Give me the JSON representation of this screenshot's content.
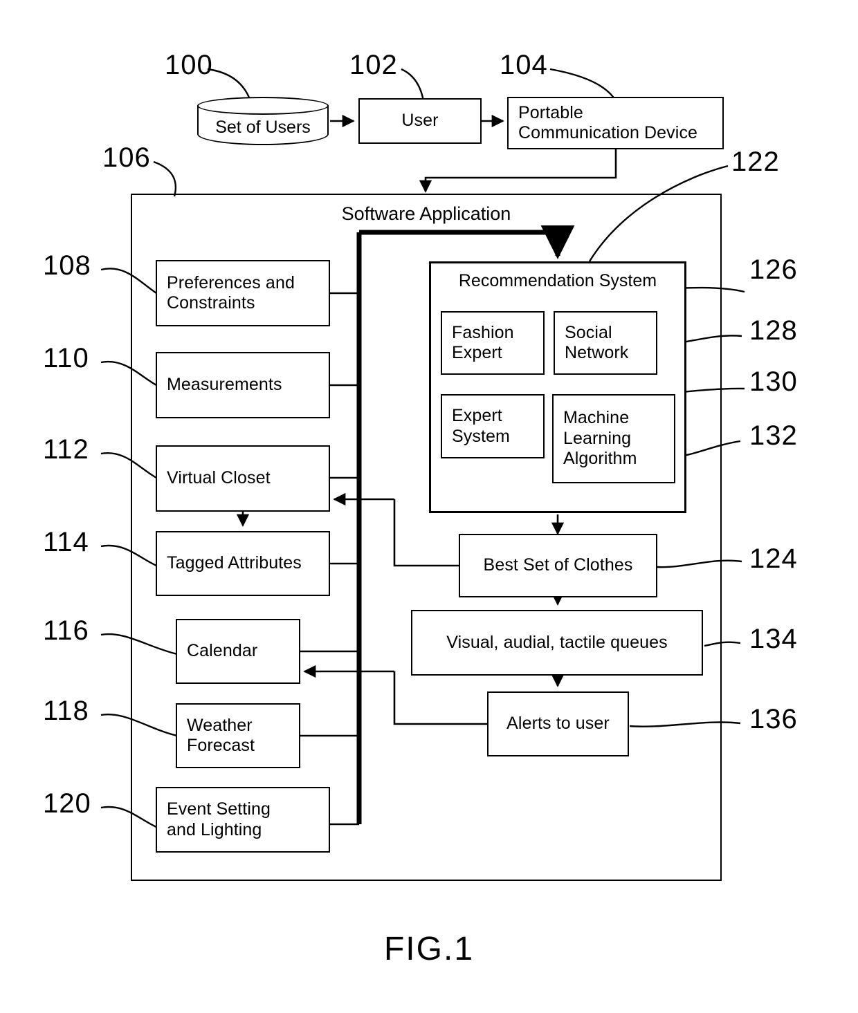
{
  "figure": {
    "caption": "FIG.1"
  },
  "containers": {
    "software_application": {
      "label": "Software Application",
      "ref": "106"
    },
    "recommendation_system": {
      "label": "Recommendation System",
      "ref": "122"
    }
  },
  "nodes": [
    {
      "id": "set-of-users",
      "label": "Set of Users",
      "ref": "100"
    },
    {
      "id": "user",
      "label": "User",
      "ref": "102"
    },
    {
      "id": "portable-communication-device",
      "label": "Portable\nCommunication Device",
      "ref": "104"
    },
    {
      "id": "preferences-and-constraints",
      "label": "Preferences and\nConstraints",
      "ref": "108"
    },
    {
      "id": "measurements",
      "label": "Measurements",
      "ref": "110"
    },
    {
      "id": "virtual-closet",
      "label": "Virtual Closet",
      "ref": "112"
    },
    {
      "id": "tagged-attributes",
      "label": "Tagged Attributes",
      "ref": "114"
    },
    {
      "id": "calendar",
      "label": "Calendar",
      "ref": "116"
    },
    {
      "id": "weather-forecast",
      "label": "Weather\nForecast",
      "ref": "118"
    },
    {
      "id": "event-setting-and-lighting",
      "label": "Event Setting\nand Lighting",
      "ref": "120"
    },
    {
      "id": "fashion-expert",
      "label": "Fashion\nExpert",
      "ref": "126"
    },
    {
      "id": "social-network",
      "label": "Social\nNetwork",
      "ref": "128"
    },
    {
      "id": "expert-system",
      "label": "Expert\nSystem",
      "ref": "130"
    },
    {
      "id": "machine-learning-algorithm",
      "label": "Machine\nLearning\nAlgorithm",
      "ref": "132"
    },
    {
      "id": "best-set-of-clothes",
      "label": "Best Set of Clothes",
      "ref": "124"
    },
    {
      "id": "visual-audial-tactile-queues",
      "label": "Visual, audial, tactile queues",
      "ref": "134"
    },
    {
      "id": "alerts-to-user",
      "label": "Alerts to user",
      "ref": "136"
    }
  ],
  "labels": {
    "set_of_users": "Set of Users",
    "user": "User",
    "portable_communication_device_l1": "Portable",
    "portable_communication_device_l2": "Communication Device",
    "software_application": "Software Application",
    "recommendation_system": "Recommendation System",
    "preferences_and_constraints_l1": "Preferences and",
    "preferences_and_constraints_l2": "Constraints",
    "measurements": "Measurements",
    "virtual_closet": "Virtual Closet",
    "tagged_attributes": "Tagged Attributes",
    "calendar": "Calendar",
    "weather_forecast_l1": "Weather",
    "weather_forecast_l2": "Forecast",
    "event_setting_l1": "Event Setting",
    "event_setting_l2": "and Lighting",
    "fashion_expert_l1": "Fashion",
    "fashion_expert_l2": "Expert",
    "social_network_l1": "Social",
    "social_network_l2": "Network",
    "expert_system_l1": "Expert",
    "expert_system_l2": "System",
    "machine_learning_l1": "Machine",
    "machine_learning_l2": "Learning",
    "machine_learning_l3": "Algorithm",
    "best_set_of_clothes": "Best Set of Clothes",
    "visual_audial_tactile_queues": "Visual, audial, tactile queues",
    "alerts_to_user": "Alerts to user"
  },
  "reference_numerals": {
    "n100": "100",
    "n102": "102",
    "n104": "104",
    "n106": "106",
    "n108": "108",
    "n110": "110",
    "n112": "112",
    "n114": "114",
    "n116": "116",
    "n118": "118",
    "n120": "120",
    "n122": "122",
    "n124": "124",
    "n126": "126",
    "n128": "128",
    "n130": "130",
    "n132": "132",
    "n134": "134",
    "n136": "136"
  },
  "colors": {
    "ink": "#000000",
    "paper": "#ffffff"
  }
}
